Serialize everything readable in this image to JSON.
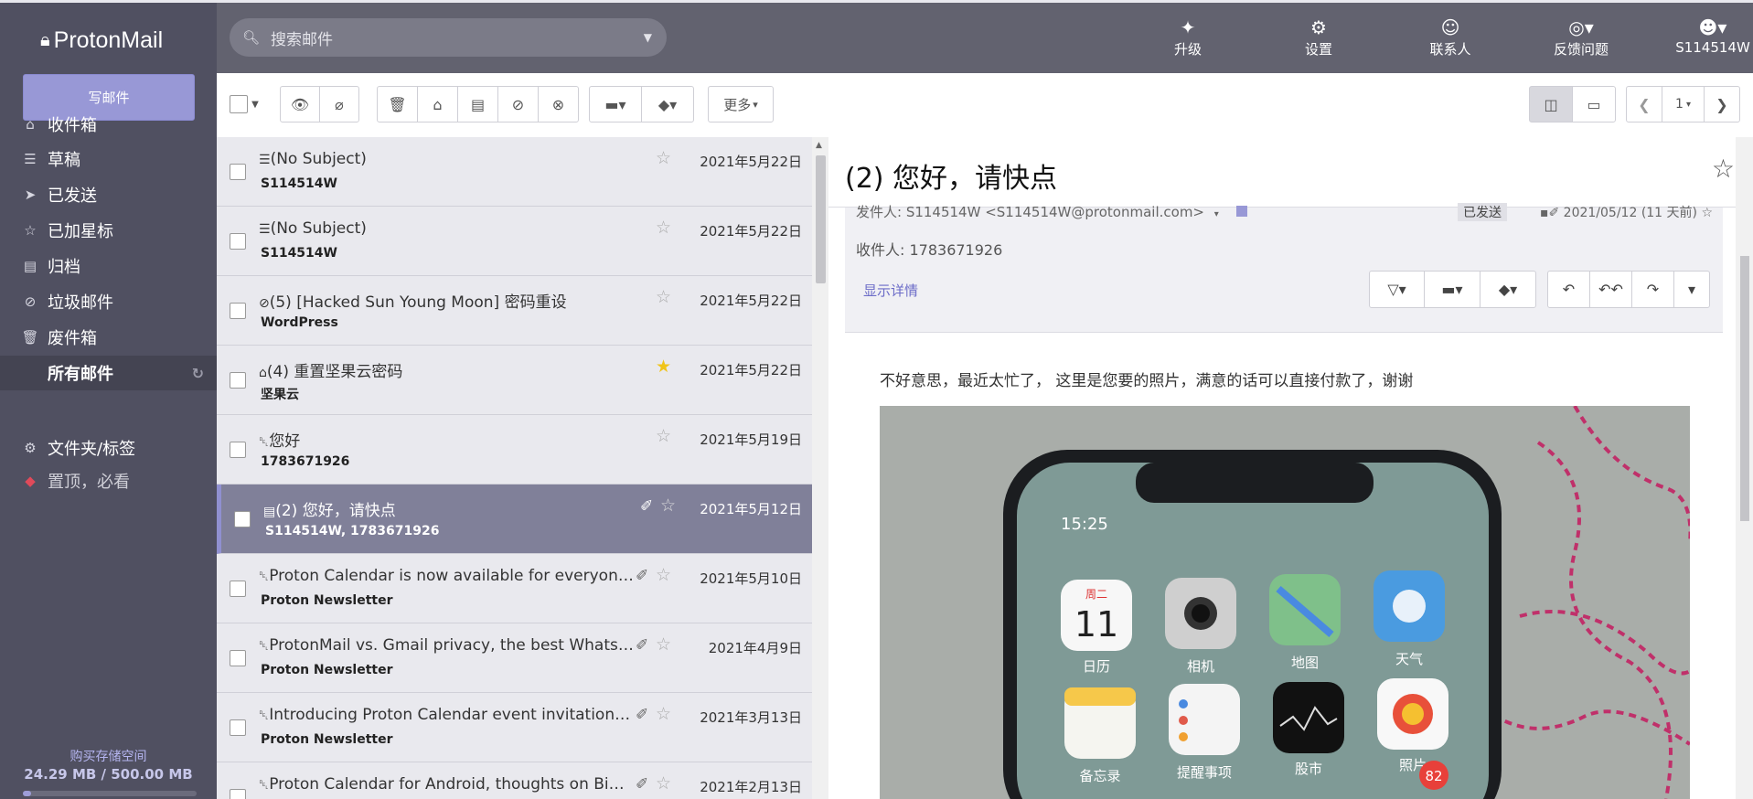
{
  "sidebar": {
    "logo_text": "ProtonMail",
    "compose_label": "写邮件",
    "items": [
      {
        "label": "收件箱",
        "icon": "inbox-icon"
      },
      {
        "label": "草稿",
        "icon": "draft-icon"
      },
      {
        "label": "已发送",
        "icon": "send-icon"
      },
      {
        "label": "已加星标",
        "icon": "star-icon"
      },
      {
        "label": "归档",
        "icon": "archive-icon"
      },
      {
        "label": "垃圾邮件",
        "icon": "spam-icon"
      },
      {
        "label": "废件箱",
        "icon": "trash-icon"
      },
      {
        "label": "所有邮件",
        "icon": "all-mail-icon"
      },
      {
        "label": "文件夹/标签",
        "icon": "gear-icon"
      },
      {
        "label": "置顶，必看",
        "icon": "tag-icon"
      }
    ],
    "storage_link": "购买存储空间",
    "storage_value": "24.29 MB / 500.00 MB",
    "storage_fraction": 0.049
  },
  "header": {
    "search_placeholder": "搜索邮件",
    "nav": [
      {
        "label": "升级",
        "icon": "upgrade-icon"
      },
      {
        "label": "设置",
        "icon": "settings-icon"
      },
      {
        "label": "联系人",
        "icon": "contacts-icon"
      },
      {
        "label": "反馈问题",
        "icon": "support-icon"
      },
      {
        "label": "S114514W",
        "icon": "user-icon"
      }
    ]
  },
  "toolbar": {
    "more_label": "更多",
    "page_label": "1"
  },
  "messages": [
    {
      "subject": "(No Subject)",
      "from": "S114514W",
      "date": "2021年5月22日",
      "icon": "draft-icon",
      "starred": false,
      "attachment": false,
      "selected": false
    },
    {
      "subject": "(No Subject)",
      "from": "S114514W",
      "date": "2021年5月22日",
      "icon": "draft-icon",
      "starred": false,
      "attachment": false,
      "selected": false
    },
    {
      "subject": "(5) [Hacked Sun Young Moon] 密码重设",
      "from": "WordPress",
      "date": "2021年5月22日",
      "icon": "spam-icon",
      "starred": false,
      "attachment": false,
      "selected": false
    },
    {
      "subject": "(4) 重置坚果云密码",
      "from": "坚果云",
      "date": "2021年5月22日",
      "icon": "inbox-icon",
      "starred": true,
      "attachment": false,
      "selected": false
    },
    {
      "subject": "您好",
      "from": "1783671926",
      "date": "2021年5月19日",
      "icon": "trash-icon",
      "starred": false,
      "attachment": false,
      "selected": false
    },
    {
      "subject": "(2) 您好，请快点",
      "from": "S114514W, 1783671926",
      "date": "2021年5月12日",
      "icon": "archive-icon",
      "starred": false,
      "attachment": true,
      "selected": true
    },
    {
      "subject": "Proton Calendar is now available for everyone a...",
      "from": "Proton Newsletter",
      "date": "2021年5月10日",
      "icon": "trash-icon",
      "starred": false,
      "attachment": true,
      "selected": false
    },
    {
      "subject": "ProtonMail vs. Gmail privacy, the best WhatsApp...",
      "from": "Proton Newsletter",
      "date": "2021年4月9日",
      "icon": "trash-icon",
      "starred": false,
      "attachment": true,
      "selected": false
    },
    {
      "subject": "Introducing Proton Calendar event invitations, N...",
      "from": "Proton Newsletter",
      "date": "2021年3月13日",
      "icon": "trash-icon",
      "starred": false,
      "attachment": true,
      "selected": false
    },
    {
      "subject": "Proton Calendar for Android, thoughts on Big Tec...",
      "from": "",
      "date": "2021年2月13日",
      "icon": "trash-icon",
      "starred": false,
      "attachment": true,
      "selected": false
    }
  ],
  "reader": {
    "title": "(2) 您好，请快点",
    "sender_line": "发件人: S114514W <S114514W@protonmail.com>",
    "status_badge": "已发送",
    "sent_time": "2021/05/12 (11 天前)",
    "recipient": "收件人: 1783671926",
    "show_details": "显示详情",
    "body": "不好意思，最近太忙了， 这里是您要的照片，满意的话可以直接付款了，谢谢",
    "photo": {
      "clock": "15:25",
      "apps": [
        {
          "label": "日历",
          "day": "周二",
          "date": "11"
        },
        {
          "label": "相机"
        },
        {
          "label": "地图"
        },
        {
          "label": "天气"
        },
        {
          "label": "备忘录"
        },
        {
          "label": "提醒事项"
        },
        {
          "label": "股市"
        },
        {
          "label": "照片",
          "badge": "82"
        }
      ]
    }
  },
  "colors": {
    "sidebar_bg": "#505061",
    "header_bg": "#62626f",
    "compose_bg": "#9898d6",
    "selected_row_bg": "#808099",
    "star_on": "#f0c419"
  }
}
